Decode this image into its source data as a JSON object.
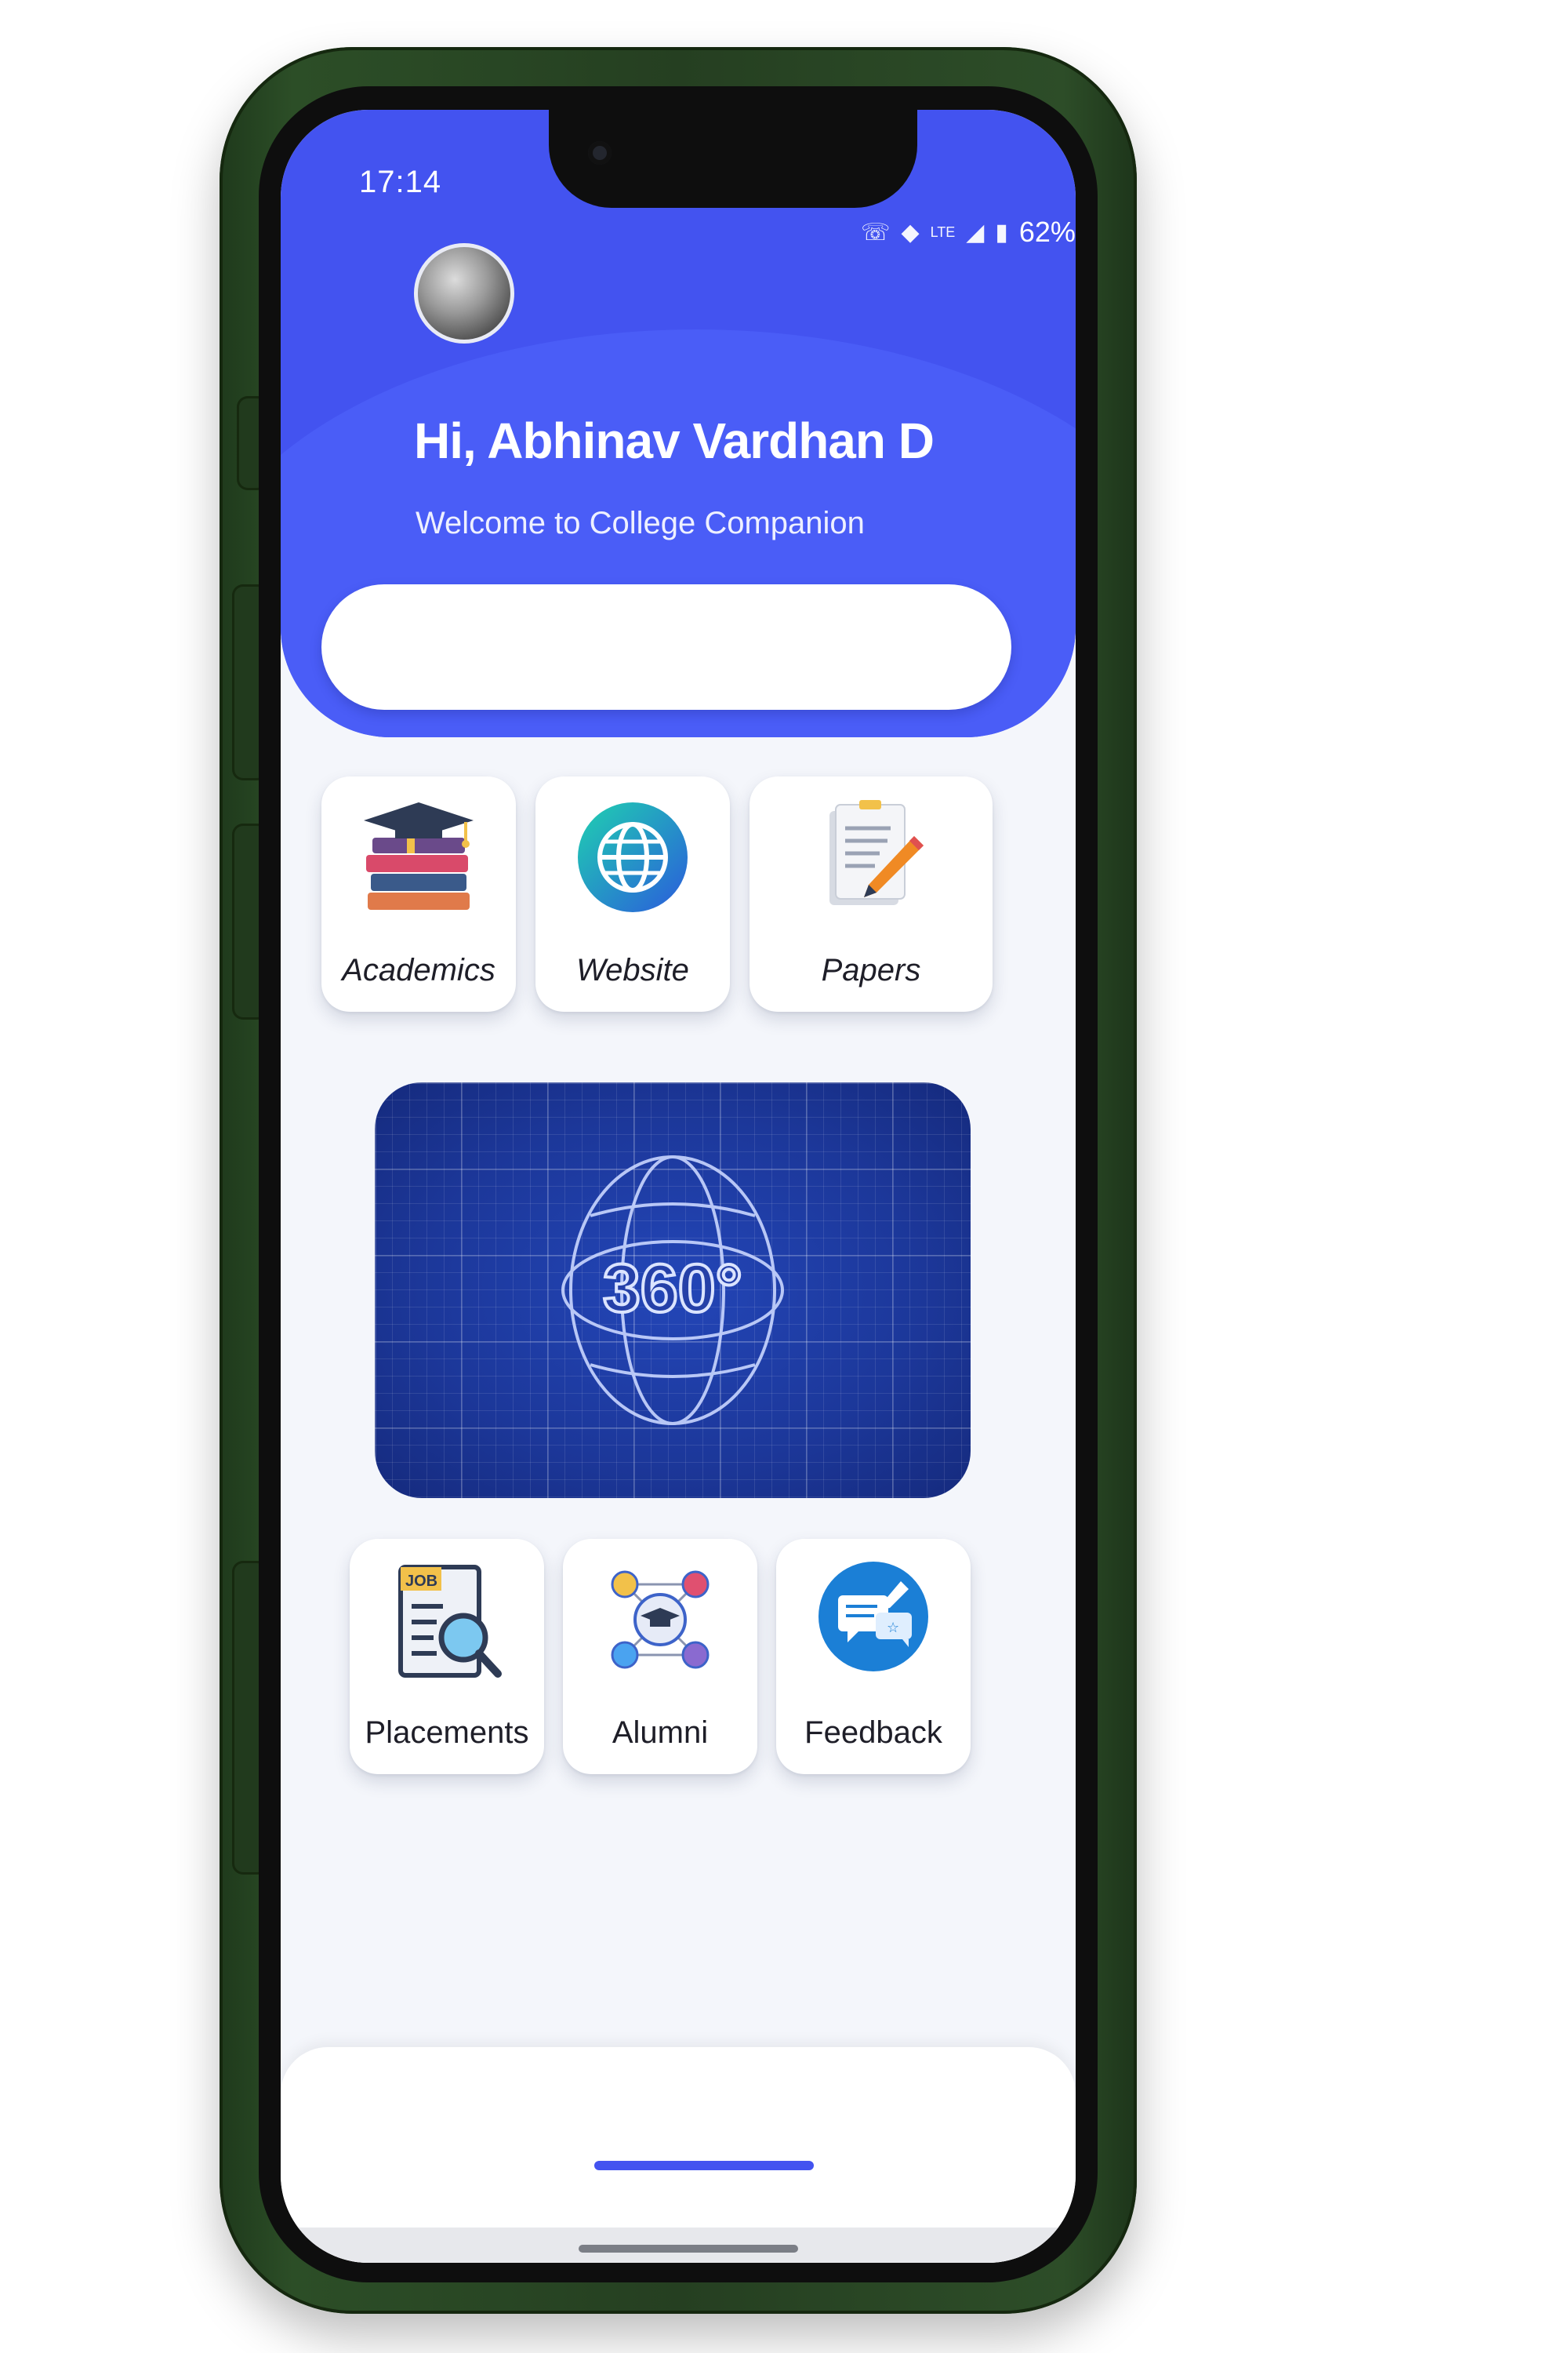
{
  "status_bar": {
    "time": "17:14",
    "battery": "62%",
    "icons": [
      "wifi-calling-icon",
      "wifi-icon",
      "lte-icon",
      "signal-icon",
      "battery-icon"
    ]
  },
  "header": {
    "greeting": "Hi, Abhinav Vardhan D",
    "subtitle": "Welcome to College Companion",
    "search": {
      "value": "",
      "placeholder": ""
    },
    "background_color": "#4353f0"
  },
  "menu_top": [
    {
      "label": "Academics",
      "icon": "books-graduation-cap-icon"
    },
    {
      "label": "Website",
      "icon": "globe-icon"
    },
    {
      "label": "Papers",
      "icon": "document-pencil-icon"
    }
  ],
  "banner": {
    "label": "360°",
    "icon": "globe-360-icon"
  },
  "menu_bottom": [
    {
      "label": "Placements",
      "icon": "job-search-icon"
    },
    {
      "label": "Alumni",
      "icon": "alumni-network-icon"
    },
    {
      "label": "Feedback",
      "icon": "feedback-chat-icon"
    }
  ]
}
